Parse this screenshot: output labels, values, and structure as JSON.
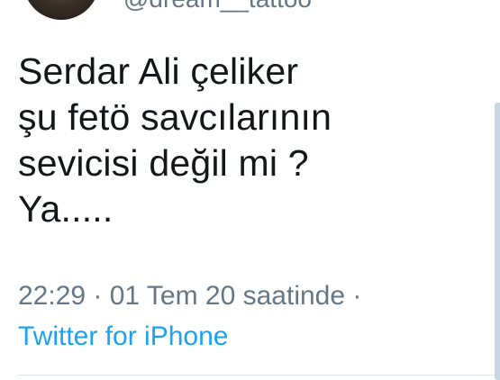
{
  "header": {
    "handle": "@dream__tattoo"
  },
  "tweet": {
    "lines": [
      "Serdar Ali çeliker",
      "şu fetö savcılarının",
      "sevicisi değil mi ?",
      "Ya....."
    ],
    "timestamp": "22:29 · 01 Tem 20 saatinde ·",
    "source": "Twitter for iPhone"
  },
  "colors": {
    "text": "#14171a",
    "muted": "#657786",
    "link": "#1da1f2"
  }
}
